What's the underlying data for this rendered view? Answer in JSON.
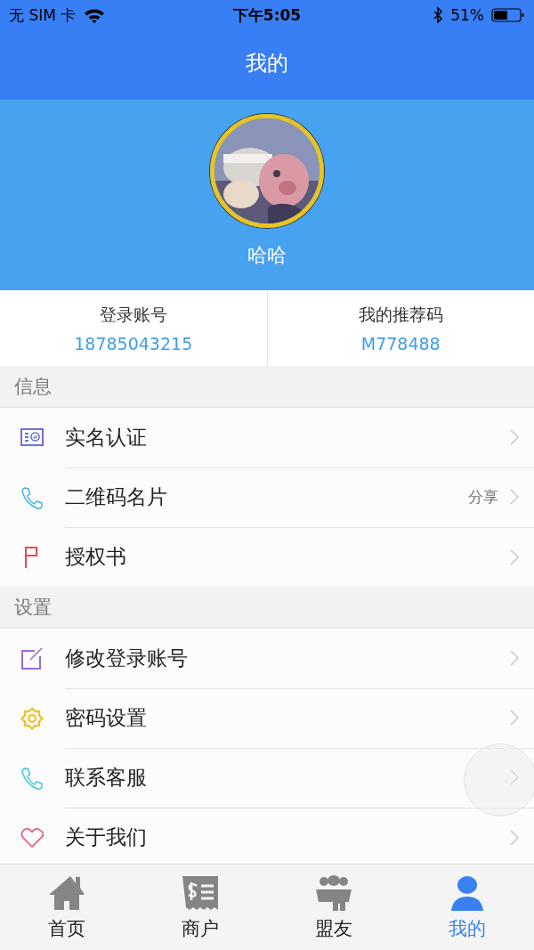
{
  "status_bar": {
    "carrier": "无 SIM 卡",
    "time": "下午5:05",
    "battery": "51%"
  },
  "nav": {
    "title": "我的"
  },
  "profile": {
    "name": "哈哈"
  },
  "account": [
    {
      "label": "登录账号",
      "value": "18785043215"
    },
    {
      "label": "我的推荐码",
      "value": "M778488"
    }
  ],
  "sections": [
    {
      "title": "信息",
      "items": [
        {
          "kind": "id-card",
          "label": "实名认证",
          "color": "#6b72d6"
        },
        {
          "kind": "phone",
          "label": "二维码名片",
          "color": "#3fb0e8",
          "detail": "分享"
        },
        {
          "kind": "flag",
          "label": "授权书",
          "color": "#e8475f"
        }
      ]
    },
    {
      "title": "设置",
      "items": [
        {
          "kind": "edit",
          "label": "修改登录账号",
          "color": "#9b6ad6"
        },
        {
          "kind": "gear",
          "label": "密码设置",
          "color": "#f2c12e"
        },
        {
          "kind": "phone",
          "label": "联系客服",
          "color": "#3cc6e0"
        },
        {
          "kind": "heart",
          "label": "关于我们",
          "color": "#ee4d7c"
        }
      ]
    }
  ],
  "tabs": [
    {
      "kind": "home",
      "label": "首页",
      "selected": false
    },
    {
      "kind": "bill",
      "label": "商户",
      "selected": false
    },
    {
      "kind": "group",
      "label": "盟友",
      "selected": false
    },
    {
      "kind": "person",
      "label": "我的",
      "selected": true
    }
  ]
}
